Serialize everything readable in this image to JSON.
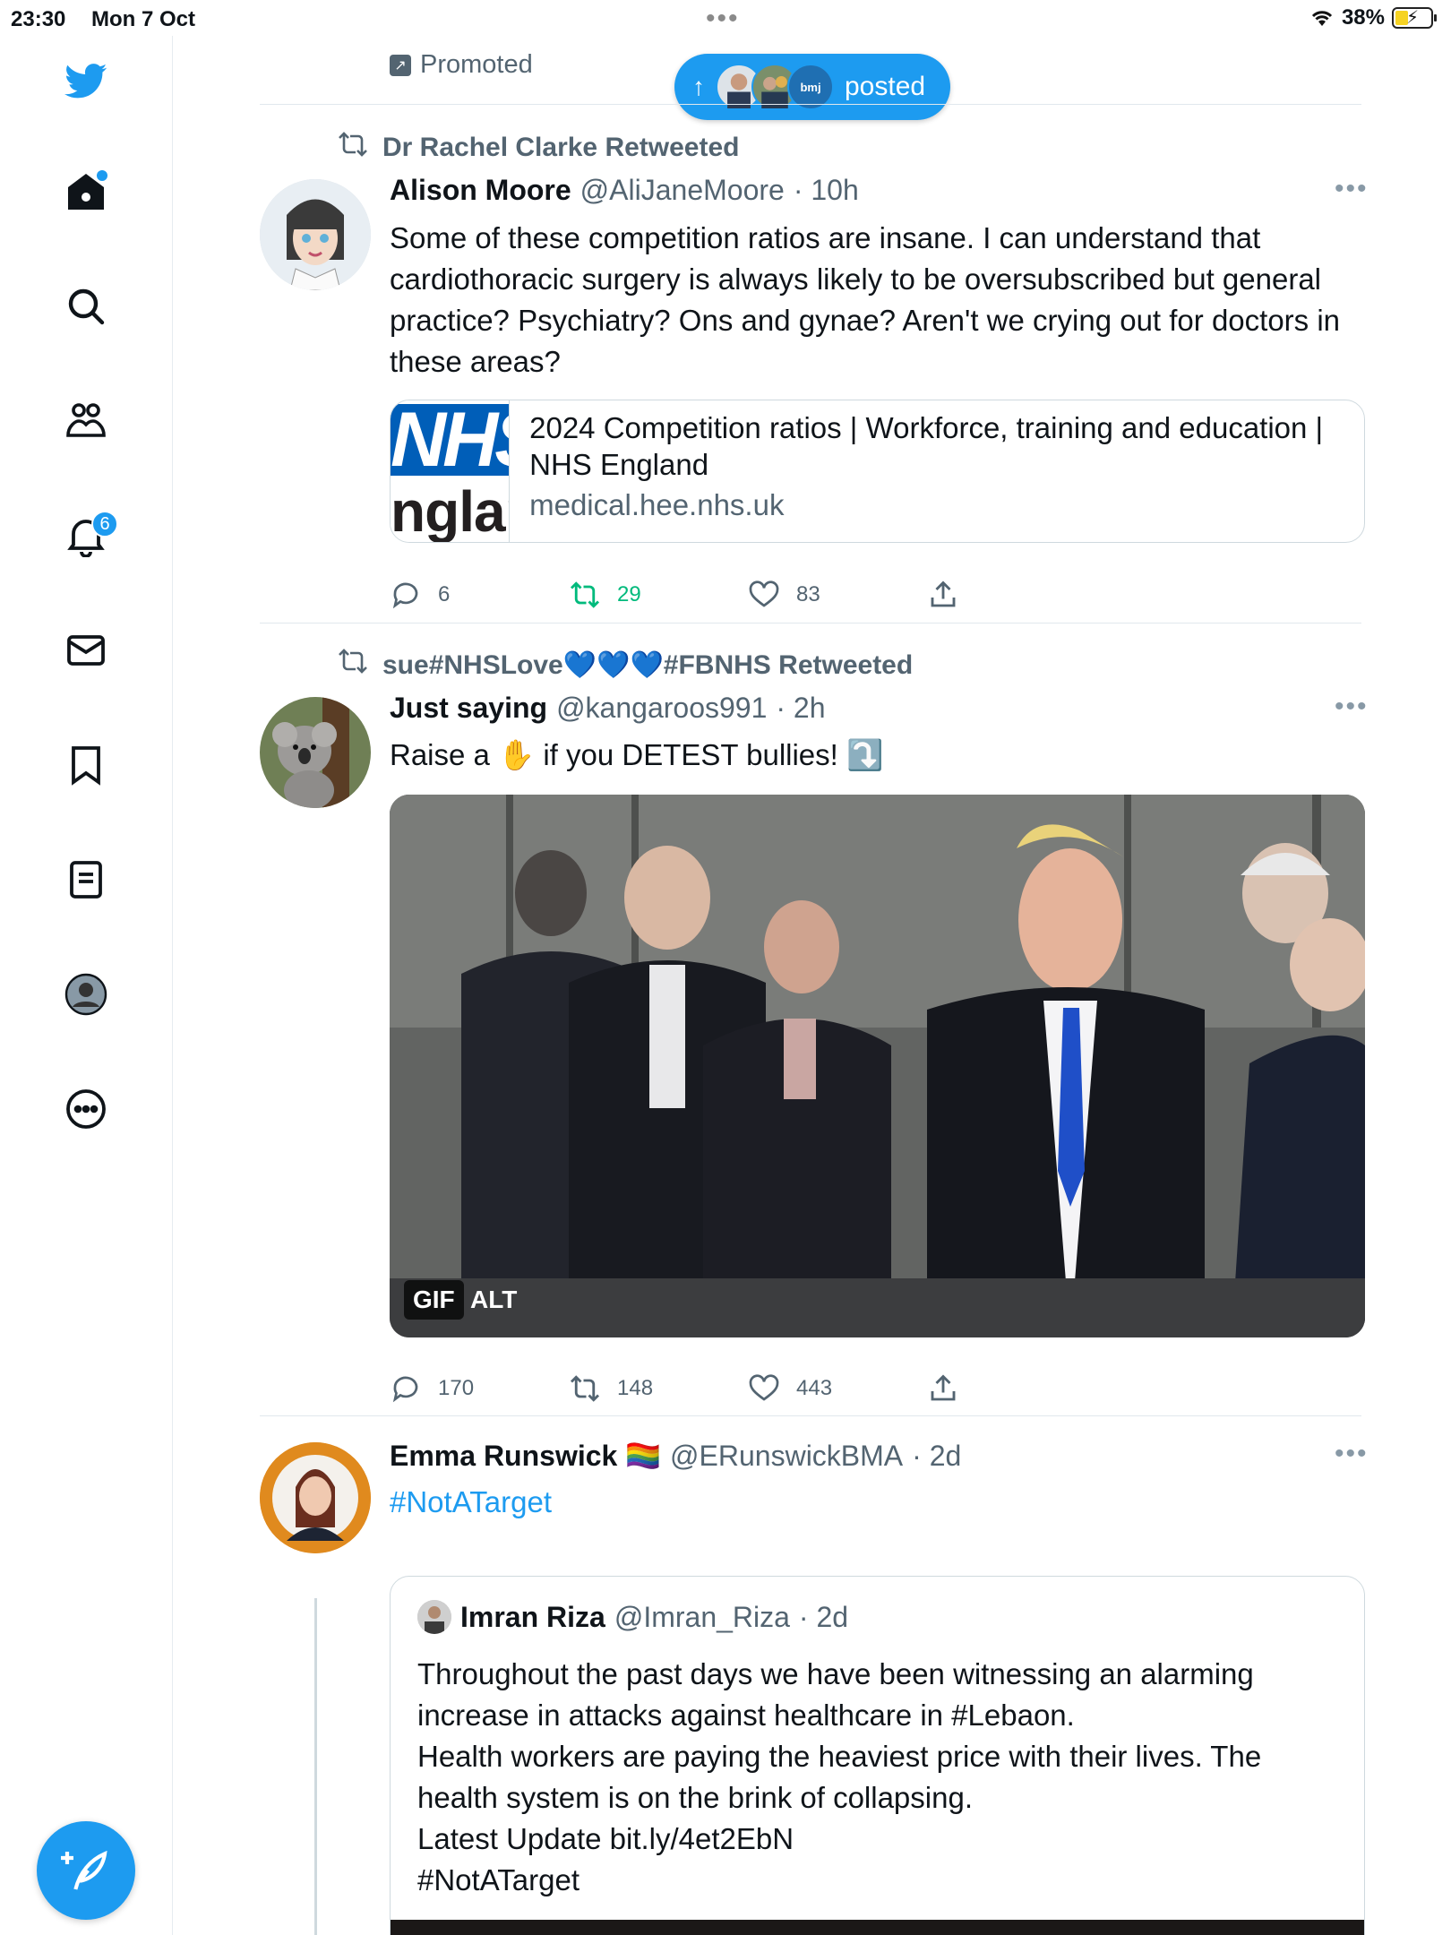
{
  "status_bar": {
    "time": "23:30",
    "date": "Mon 7 Oct",
    "battery": "38%",
    "battery_level": 0.38
  },
  "sidebar": {
    "notifications_badge": "6",
    "items": [
      "home-icon",
      "search-icon",
      "communities-icon",
      "notifications-icon",
      "messages-icon",
      "bookmarks-icon",
      "lists-icon",
      "profile-icon",
      "more-icon"
    ]
  },
  "timeline": {
    "promoted_label": "Promoted",
    "new_posts_pill": {
      "label": "posted",
      "avatar_text": "bmj"
    },
    "tweets": [
      {
        "retweeted_by": "Dr Rachel Clarke Retweeted",
        "name": "Alison Moore",
        "handle": "@AliJaneMoore",
        "time": "· 10h",
        "text": "Some of these competition ratios are insane. I can understand that cardiothoracic surgery is always likely to be oversubscribed but general practice? Psychiatry? Ons and gynae? Aren't we crying out for doctors in these areas?",
        "link_card": {
          "thumb_top": "NHS",
          "thumb_bottom": "nglan",
          "title": "2024 Competition ratios | Workforce, training and education | NHS England",
          "domain": "medical.hee.nhs.uk"
        },
        "replies": "6",
        "retweets": "29",
        "likes": "83"
      },
      {
        "retweeted_by": "sue#NHSLove💙💙💙#FBNHS Retweeted",
        "name": "Just saying",
        "handle": "@kangaroos991",
        "time": "· 2h",
        "text": "Raise a ✋ if you DETEST bullies! ⤵️",
        "media_tags": [
          "GIF",
          "ALT"
        ],
        "replies": "170",
        "retweets": "148",
        "likes": "443"
      },
      {
        "name": "Emma Runswick 🏳️‍🌈",
        "handle": "@ERunswickBMA",
        "time": "· 2d",
        "text": "#NotATarget",
        "quote": {
          "name": "Imran Riza",
          "handle": "@Imran_Riza",
          "time": "· 2d",
          "lines": [
            "Throughout the past days we have been witnessing an alarming increase in attacks against healthcare in #Lebaon.",
            "Health workers are paying the heaviest price with their lives. The health system is on the brink of collapsing.",
            "Latest Update bit.ly/4et2EbN",
            "#NotATarget"
          ]
        }
      }
    ]
  },
  "colors": {
    "accent": "#1d9bf0",
    "retweet_active": "#00ba7c",
    "secondary_text": "#536471",
    "nhs_blue": "#005eb8"
  }
}
